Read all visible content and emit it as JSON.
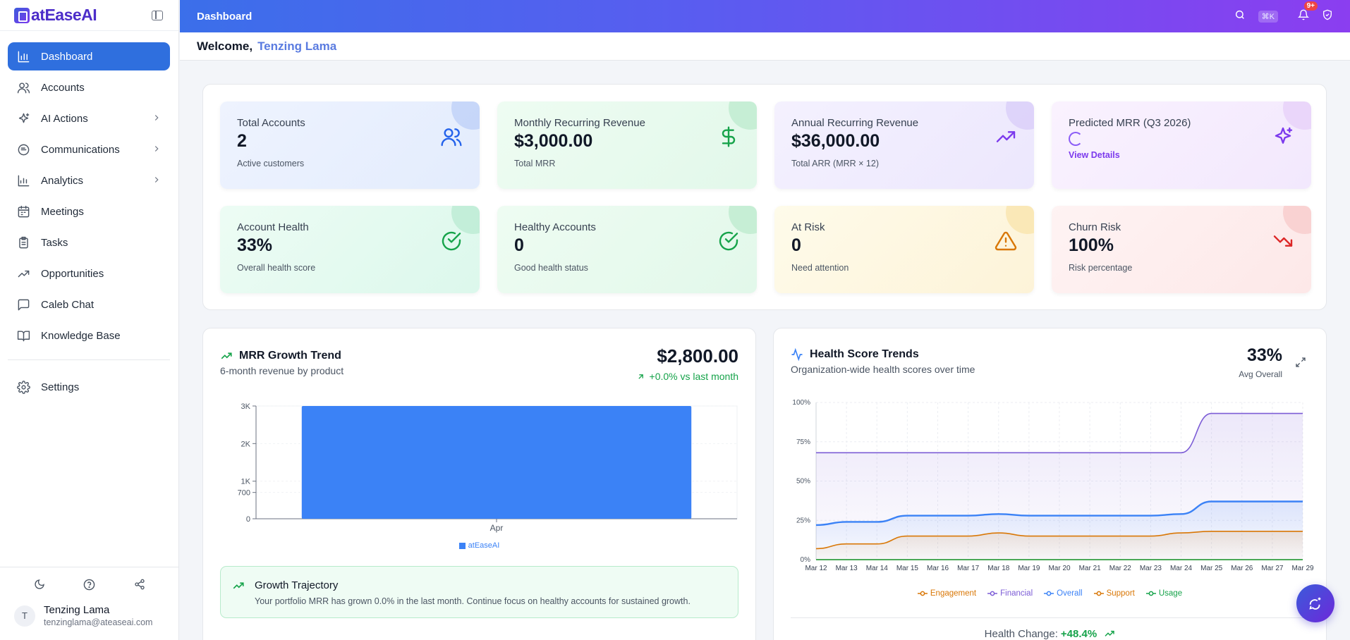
{
  "app": {
    "name": "atEaseAI",
    "page_title": "Dashboard"
  },
  "sidebar": {
    "items": [
      {
        "label": "Dashboard",
        "icon": "bar-chart-icon",
        "active": true,
        "has_submenu": false
      },
      {
        "label": "Accounts",
        "icon": "users-icon",
        "has_submenu": false
      },
      {
        "label": "AI Actions",
        "icon": "sparkles-icon",
        "has_submenu": true
      },
      {
        "label": "Communications",
        "icon": "chat-icon",
        "has_submenu": true
      },
      {
        "label": "Analytics",
        "icon": "analytics-icon",
        "has_submenu": true
      },
      {
        "label": "Meetings",
        "icon": "calendar-icon",
        "has_submenu": false
      },
      {
        "label": "Tasks",
        "icon": "clipboard-icon",
        "has_submenu": false
      },
      {
        "label": "Opportunities",
        "icon": "trending-up-icon",
        "has_submenu": false
      },
      {
        "label": "Caleb Chat",
        "icon": "message-square-icon",
        "has_submenu": false
      },
      {
        "label": "Knowledge Base",
        "icon": "book-icon",
        "has_submenu": false
      }
    ],
    "settings_label": "Settings",
    "user": {
      "initial": "T",
      "name": "Tenzing Lama",
      "email": "tenzinglama@ateaseai.com"
    }
  },
  "topbar": {
    "title": "Dashboard",
    "shortcut": "⌘K",
    "notification_count": "9+"
  },
  "welcome": {
    "greeting": "Welcome,",
    "name": "Tenzing Lama"
  },
  "stats": [
    {
      "label": "Total Accounts",
      "value": "2",
      "sub": "Active customers",
      "icon": "users-icon",
      "color": "#2563eb"
    },
    {
      "label": "Monthly Recurring Revenue",
      "value": "$3,000.00",
      "sub": "Total MRR",
      "icon": "dollar-icon",
      "color": "#16a34a"
    },
    {
      "label": "Annual Recurring Revenue",
      "value": "$36,000.00",
      "sub": "Total ARR (MRR × 12)",
      "icon": "trending-up-icon",
      "color": "#7c3aed"
    },
    {
      "label": "Predicted MRR (Q3 2026)",
      "value": "",
      "sub": "View Details",
      "icon": "sparkles-icon",
      "color": "#7c3aed"
    },
    {
      "label": "Account Health",
      "value": "33%",
      "sub": "Overall health score",
      "icon": "check-circle-icon",
      "color": "#16a34a"
    },
    {
      "label": "Healthy Accounts",
      "value": "0",
      "sub": "Good health status",
      "icon": "check-circle-icon",
      "color": "#16a34a"
    },
    {
      "label": "At Risk",
      "value": "0",
      "sub": "Need attention",
      "icon": "warning-icon",
      "color": "#d97706"
    },
    {
      "label": "Churn Risk",
      "value": "100%",
      "sub": "Risk percentage",
      "icon": "trending-down-icon",
      "color": "#dc2626"
    }
  ],
  "mrr": {
    "title": "MRR Growth Trend",
    "subtitle": "6-month revenue by product",
    "total": "$2,800.00",
    "delta": "+0.0% vs last month",
    "growth_title": "Growth Trajectory",
    "growth_text": "Your portfolio MRR has grown 0.0% in the last month. Continue focus on healthy accounts for sustained growth."
  },
  "health": {
    "title": "Health Score Trends",
    "subtitle": "Organization-wide health scores over time",
    "avg_value": "33%",
    "avg_label": "Avg Overall",
    "change_label": "Health Change:",
    "change_value": "+48.4%"
  },
  "chart_data": [
    {
      "type": "bar",
      "categories": [
        "Apr"
      ],
      "series": [
        {
          "name": "atEaseAI",
          "values": [
            3000
          ],
          "color": "#3b82f6"
        }
      ],
      "yticks": [
        "0",
        "700",
        "1K",
        "2K",
        "3K"
      ],
      "ylim": [
        0,
        3000
      ]
    },
    {
      "type": "area",
      "x": [
        "Mar 12",
        "Mar 13",
        "Mar 14",
        "Mar 15",
        "Mar 16",
        "Mar 17",
        "Mar 18",
        "Mar 19",
        "Mar 20",
        "Mar 21",
        "Mar 22",
        "Mar 23",
        "Mar 24",
        "Mar 25",
        "Mar 26",
        "Mar 27",
        "Mar 29"
      ],
      "yticks": [
        "0%",
        "25%",
        "50%",
        "75%",
        "100%"
      ],
      "ylim": [
        0,
        100
      ],
      "series": [
        {
          "name": "Engagement",
          "color": "#d97706",
          "values": [
            7,
            10,
            10,
            15,
            15,
            15,
            17,
            15,
            15,
            15,
            15,
            15,
            17,
            18,
            18,
            18,
            18
          ]
        },
        {
          "name": "Financial",
          "color": "#7c5cd6",
          "values": [
            68,
            68,
            68,
            68,
            68,
            68,
            68,
            68,
            68,
            68,
            68,
            68,
            68,
            93,
            93,
            93,
            93
          ]
        },
        {
          "name": "Overall",
          "color": "#3b82f6",
          "values": [
            22,
            24,
            24,
            28,
            28,
            28,
            29,
            28,
            28,
            28,
            28,
            28,
            29,
            37,
            37,
            37,
            37
          ]
        },
        {
          "name": "Support",
          "color": "#d97706",
          "values": [
            0,
            0,
            0,
            0,
            0,
            0,
            0,
            0,
            0,
            0,
            0,
            0,
            0,
            0,
            0,
            0,
            0
          ]
        },
        {
          "name": "Usage",
          "color": "#16a34a",
          "values": [
            0,
            0,
            0,
            0,
            0,
            0,
            0,
            0,
            0,
            0,
            0,
            0,
            0,
            0,
            0,
            0,
            0
          ]
        }
      ]
    }
  ]
}
